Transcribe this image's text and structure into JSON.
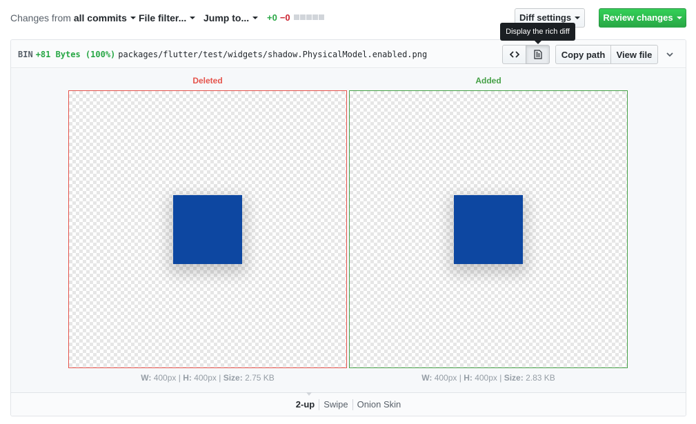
{
  "toolbar": {
    "changes_prefix": "Changes from",
    "changes_value": "all commits",
    "file_filter": "File filter...",
    "jump_to": "Jump to...",
    "additions": "+0",
    "deletions": "−0",
    "diff_settings": "Diff settings",
    "review_changes": "Review changes",
    "review_color": "#28a745"
  },
  "tooltip": {
    "text": "Display the rich diff"
  },
  "file": {
    "type": "BIN",
    "size_change": "+81 Bytes (100%)",
    "path": "packages/flutter/test/widgets/shadow.PhysicalModel.enabled.png",
    "copy_path": "Copy path",
    "view_file": "View file",
    "icons": {
      "source": "code-icon",
      "rich": "file-text-icon",
      "collapse": "chevron-down-icon"
    }
  },
  "diff": {
    "deleted": {
      "label": "Deleted",
      "color": "#e5534b",
      "w_label": "W:",
      "w_value": "400px",
      "h_label": "H:",
      "h_value": "400px",
      "size_label": "Size:",
      "size_value": "2.75 KB",
      "square_color": "#0d47a1"
    },
    "added": {
      "label": "Added",
      "color": "#45a046",
      "w_label": "W:",
      "w_value": "400px",
      "h_label": "H:",
      "h_value": "400px",
      "size_label": "Size:",
      "size_value": "2.83 KB",
      "square_color": "#0d47a1"
    }
  },
  "view_modes": {
    "two_up": "2-up",
    "swipe": "Swipe",
    "onion": "Onion Skin",
    "selected": "2-up"
  }
}
